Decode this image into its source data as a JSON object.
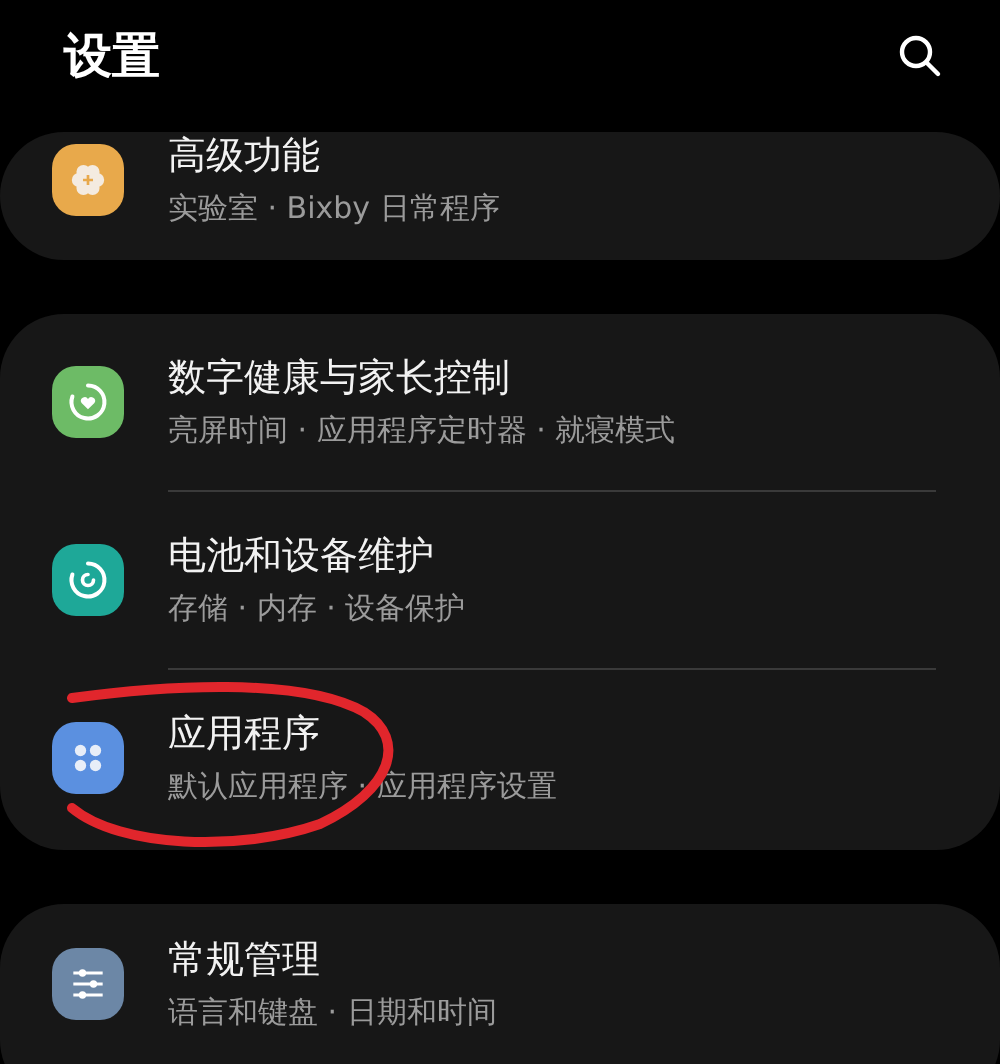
{
  "header": {
    "title": "设置"
  },
  "sections": [
    {
      "items": [
        {
          "title": "高级功能",
          "subtitle": "实验室 · Bixby 日常程序",
          "color": "#e8a94b"
        }
      ]
    },
    {
      "items": [
        {
          "title": "数字健康与家长控制",
          "subtitle": "亮屏时间 · 应用程序定时器 · 就寝模式",
          "color": "#6dbb66"
        },
        {
          "title": "电池和设备维护",
          "subtitle": "存储 · 内存 · 设备保护",
          "color": "#1ea898"
        },
        {
          "title": "应用程序",
          "subtitle": "默认应用程序 · 应用程序设置",
          "color": "#5b90e0"
        }
      ]
    },
    {
      "items": [
        {
          "title": "常规管理",
          "subtitle": "语言和键盘 · 日期和时间",
          "color": "#6c87a6"
        }
      ]
    }
  ]
}
